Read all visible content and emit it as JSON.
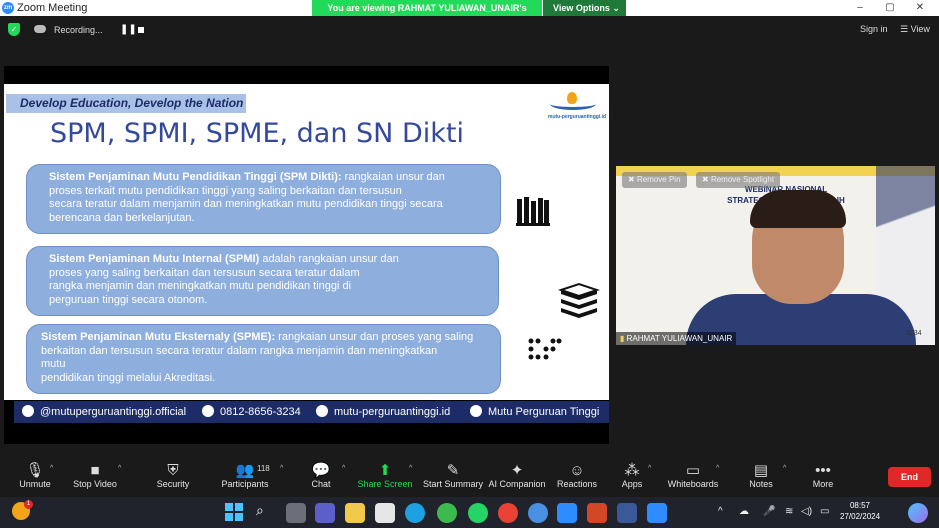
{
  "window": {
    "title": "Zoom Meeting",
    "app_icon": "zm",
    "viewing_banner": "You are viewing RAHMAT YULIAWAN_UNAIR's screen",
    "view_options": "View Options",
    "controls": [
      "–",
      "▢",
      "✕"
    ]
  },
  "meeting_bar": {
    "recording_label": "Recording...",
    "sign_in": "Sign in",
    "view": "View"
  },
  "slide": {
    "tagline": "Develop Education, Develop the Nation",
    "logo_text": "mutu-perguruantinggi.id",
    "title": "SPM, SPMI, SPME, dan SN Dikti",
    "cards": [
      {
        "term": "Sistem Penjaminan Mutu Pendidikan Tinggi (SPM Dikti):",
        "lines": [
          " rangkaian unsur dan",
          "proses terkait mutu pendidikan tinggi yang saling berkaitan dan tersusun",
          "secara teratur dalam menjamin dan meningkatkan mutu pendidikan tinggi secara",
          "berencana dan berkelanjutan."
        ]
      },
      {
        "term": "Sistem Penjaminan Mutu Internal (SPMI)",
        "lines": [
          " adalah rangkaian unsur dan",
          "proses yang saling berkaitan dan tersusun secara teratur dalam",
          "rangka menjamin dan meningkatkan mutu pendidikan tinggi di",
          "perguruan tinggi secara otonom."
        ]
      },
      {
        "term": "Sistem Penjaminan Mutu Eksternaly (SPME):",
        "lines": [
          " rangkaian unsur dan proses yang saling",
          "berkaitan dan tersusun secara teratur dalam rangka menjamin dan meningkatkan",
          "mutu",
          "pendidikan tinggi melalui Akreditasi."
        ]
      }
    ],
    "footer": {
      "instagram": "@mutuperguruantinggi.official",
      "phone": "0812-8656-3234",
      "website": "mutu-perguruantinggi.id",
      "youtube": "Mutu Perguruan Tinggi"
    }
  },
  "video_tile": {
    "remove_pin": "Remove Pin",
    "remove_spotlight": "Remove Spotlight",
    "banner_lines": [
      "WEBINAR NASIONAL",
      "STRATEGI PROGRAM          MERAIH",
      "AKRE",
      "(27"
    ],
    "corner_number": "3234",
    "participant_name": "RAHMAT YULIAWAN_UNAIR"
  },
  "toolbar": {
    "participants_count": "118",
    "items": [
      {
        "label": "Unmute",
        "icon": "mic-muted-icon"
      },
      {
        "label": "Stop Video",
        "icon": "video-camera-icon"
      },
      {
        "label": "Security",
        "icon": "shield-icon"
      },
      {
        "label": "Participants",
        "icon": "participants-icon"
      },
      {
        "label": "Chat",
        "icon": "chat-icon"
      },
      {
        "label": "Share Screen",
        "icon": "share-screen-icon"
      },
      {
        "label": "Start Summary",
        "icon": "summary-icon"
      },
      {
        "label": "AI Companion",
        "icon": "ai-companion-icon"
      },
      {
        "label": "Reactions",
        "icon": "reactions-icon"
      },
      {
        "label": "Apps",
        "icon": "apps-icon"
      },
      {
        "label": "Whiteboards",
        "icon": "whiteboard-icon"
      },
      {
        "label": "Notes",
        "icon": "notes-icon"
      },
      {
        "label": "More",
        "icon": "more-icon"
      }
    ],
    "end": "End",
    "accent_green": "#23d959",
    "end_red": "#e02828"
  },
  "taskbar": {
    "time": "08:57",
    "date": "27/02/2024",
    "notification_badge": "1"
  }
}
